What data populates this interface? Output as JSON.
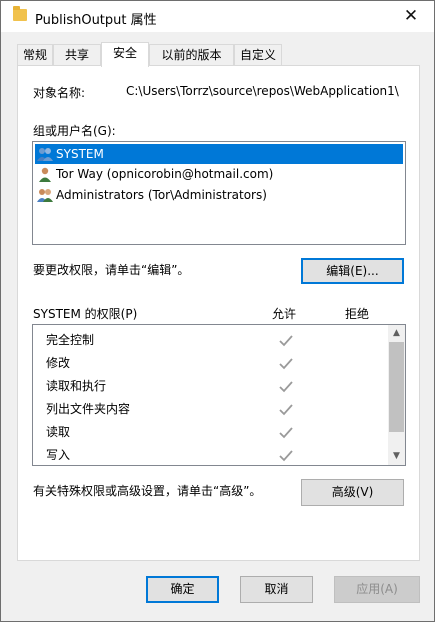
{
  "window": {
    "title": "PublishOutput 属性",
    "close_glyph": "✕"
  },
  "tabs": [
    {
      "label": "常规",
      "active": false
    },
    {
      "label": "共享",
      "active": false
    },
    {
      "label": "安全",
      "active": true
    },
    {
      "label": "以前的版本",
      "active": false
    },
    {
      "label": "自定义",
      "active": false
    }
  ],
  "security": {
    "object_name_label": "对象名称:",
    "object_name_value": "C:\\Users\\Torrz\\source\\repos\\WebApplication1\\",
    "group_label": "组或用户名(G):",
    "users": [
      {
        "name": "SYSTEM",
        "icon": "users-group-icon",
        "selected": true
      },
      {
        "name": "Tor Way (opnicorobin@hotmail.com)",
        "icon": "user-icon",
        "selected": false
      },
      {
        "name": "Administrators (Tor\\Administrators)",
        "icon": "users-group-icon",
        "selected": false
      }
    ],
    "edit_hint": "要更改权限，请单击“编辑”。",
    "edit_button": "编辑(E)...",
    "permissions_label": "SYSTEM 的权限(P)",
    "allow_header": "允许",
    "deny_header": "拒绝",
    "permissions": [
      {
        "name": "完全控制",
        "allow": true,
        "deny": false
      },
      {
        "name": "修改",
        "allow": true,
        "deny": false
      },
      {
        "name": "读取和执行",
        "allow": true,
        "deny": false
      },
      {
        "name": "列出文件夹内容",
        "allow": true,
        "deny": false
      },
      {
        "name": "读取",
        "allow": true,
        "deny": false
      },
      {
        "name": "写入",
        "allow": true,
        "deny": false
      }
    ],
    "advanced_hint": "有关特殊权限或高级设置，请单击“高级”。",
    "advanced_button": "高级(V)"
  },
  "footer": {
    "ok": "确定",
    "cancel": "取消",
    "apply": "应用(A)"
  },
  "colors": {
    "selection": "#0078d7",
    "arrow": "#e8322d",
    "check": "#9a9a9a"
  }
}
